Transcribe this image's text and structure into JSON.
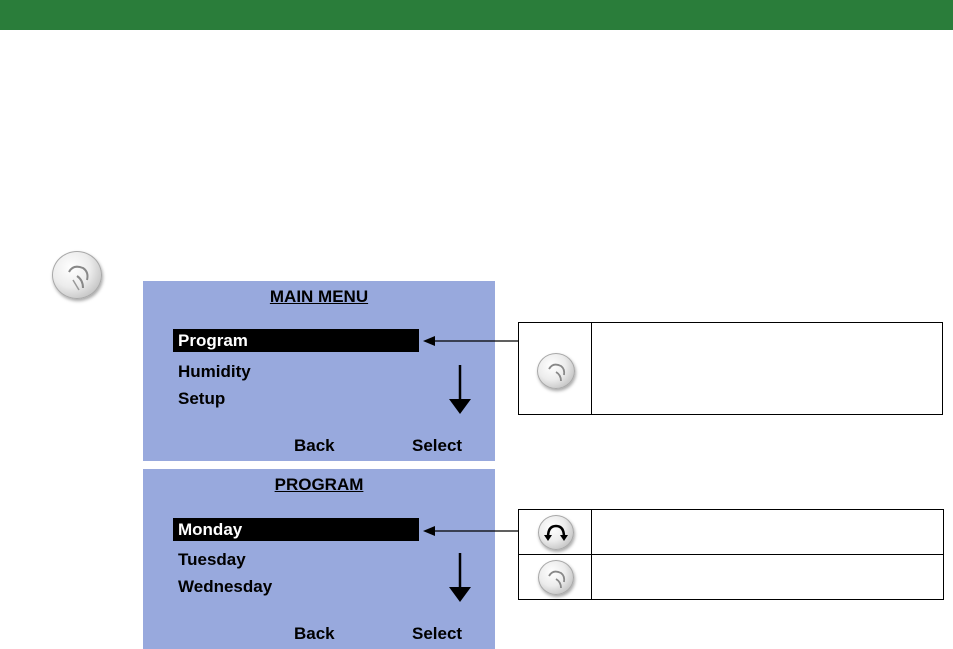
{
  "main_menu": {
    "title": "MAIN MENU",
    "items": [
      "Program",
      "Humidity",
      "Setup"
    ],
    "selected_index": 0,
    "softkeys": {
      "back": "Back",
      "select": "Select"
    }
  },
  "program_menu": {
    "title": "PROGRAM",
    "items": [
      "Monday",
      "Tuesday",
      "Wednesday"
    ],
    "selected_index": 0,
    "softkeys": {
      "back": "Back",
      "select": "Select"
    }
  },
  "icons": {
    "press_knob": "press-knob-icon",
    "rotate_knob": "rotate-knob-icon",
    "scroll_down": "arrow-down-icon",
    "pointer": "arrow-left-icon"
  },
  "colors": {
    "header_bar": "#2a7d3a",
    "screen_bg": "#98a9dd",
    "selection": "#000000"
  }
}
